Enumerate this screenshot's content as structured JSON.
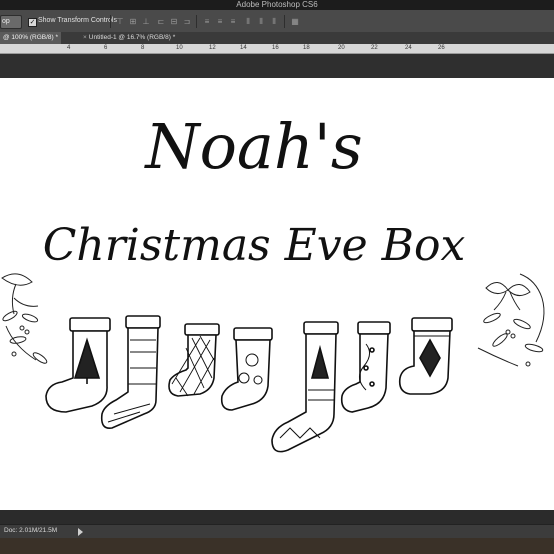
{
  "app": {
    "title": "Adobe Photoshop CS6"
  },
  "options_bar": {
    "tool_dropdown": "op",
    "show_transform_checked": true,
    "show_transform_label": "Show Transform Controls"
  },
  "tabs": [
    {
      "label": "@ 100% (RGB/8) *",
      "active": true
    },
    {
      "label": "Untitled-1 @ 16.7% (RGB/8) *",
      "active": false
    }
  ],
  "ruler": {
    "ticks": [
      "4",
      "6",
      "8",
      "10",
      "12",
      "14",
      "16",
      "18",
      "20",
      "22",
      "24",
      "26"
    ]
  },
  "canvas": {
    "heading_line1": "Noah's",
    "heading_line2": "Christmas Eve Box"
  },
  "status": {
    "doc": "Doc: 2.01M/21.5M"
  }
}
